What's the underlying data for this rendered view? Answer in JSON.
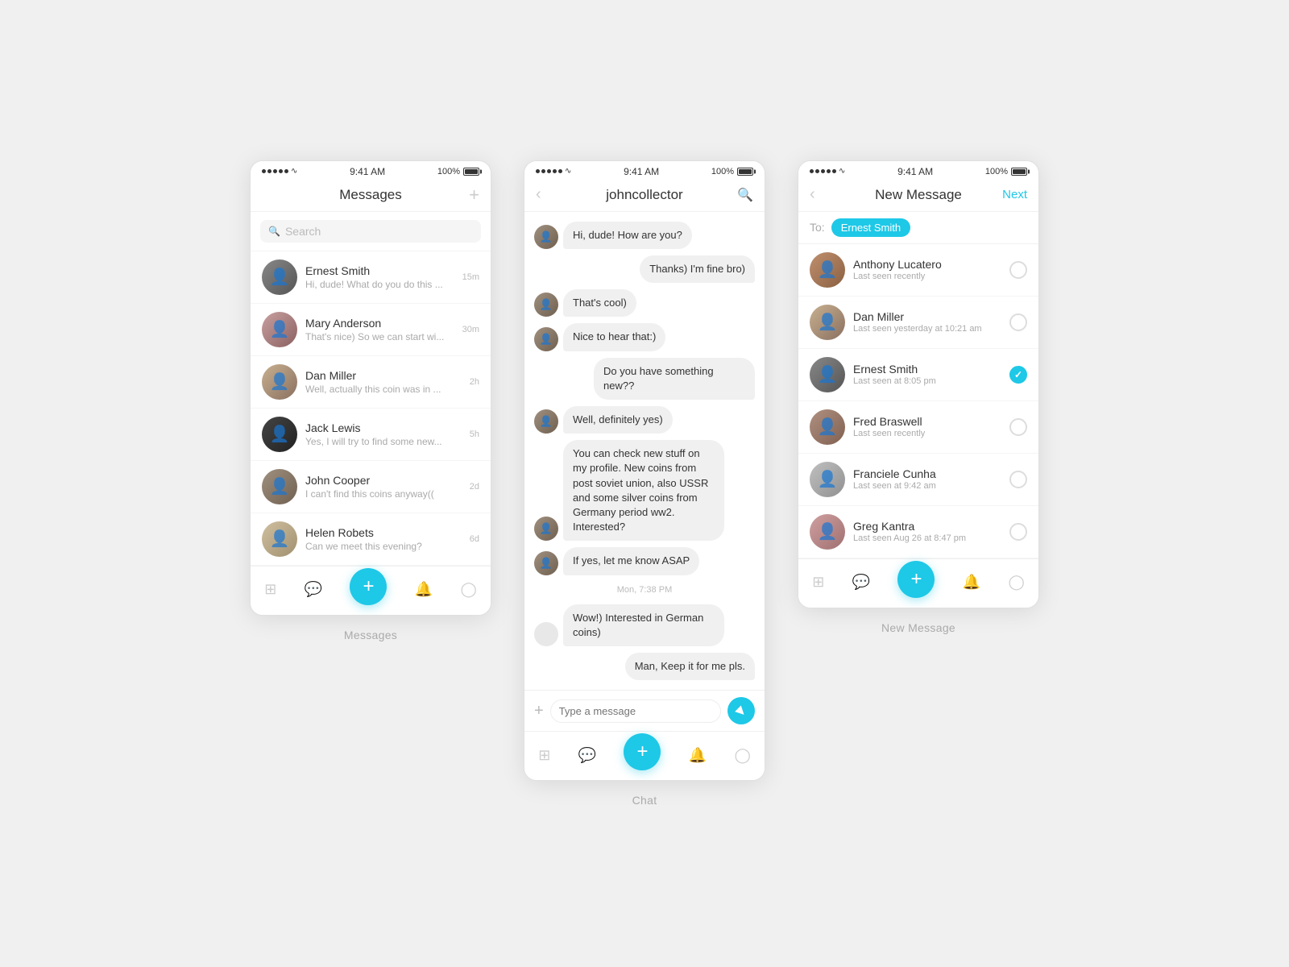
{
  "screens": [
    {
      "id": "messages",
      "label": "Messages",
      "statusBar": {
        "time": "9:41 AM",
        "battery": "100%"
      },
      "header": {
        "title": "Messages",
        "rightIcon": "plus"
      },
      "search": {
        "placeholder": "Search"
      },
      "messages": [
        {
          "id": 1,
          "name": "Ernest Smith",
          "preview": "Hi, dude! What do you do this ...",
          "time": "15m",
          "avatar": "ernest"
        },
        {
          "id": 2,
          "name": "Mary Anderson",
          "preview": "That's nice) So we can start wi...",
          "time": "30m",
          "avatar": "mary"
        },
        {
          "id": 3,
          "name": "Dan Miller",
          "preview": "Well, actually this coin was in ...",
          "time": "2h",
          "avatar": "dan"
        },
        {
          "id": 4,
          "name": "Jack Lewis",
          "preview": "Yes, I will try to find some new...",
          "time": "5h",
          "avatar": "jack"
        },
        {
          "id": 5,
          "name": "John Cooper",
          "preview": "I can't find this coins anyway((",
          "time": "2d",
          "avatar": "john"
        },
        {
          "id": 6,
          "name": "Helen Robets",
          "preview": "Can we meet this evening?",
          "time": "6d",
          "avatar": "helen"
        }
      ],
      "nav": [
        "grid",
        "chat",
        "plus",
        "bell",
        "person"
      ]
    },
    {
      "id": "chat",
      "label": "Chat",
      "statusBar": {
        "time": "9:41 AM",
        "battery": "100%"
      },
      "header": {
        "title": "johncollector",
        "leftIcon": "back",
        "rightIcon": "search"
      },
      "messages": [
        {
          "side": "left",
          "text": "Hi, dude! How are you?",
          "avatar": "john"
        },
        {
          "side": "right",
          "text": "Thanks) I'm fine bro)"
        },
        {
          "side": "left",
          "text": "That's cool)",
          "avatar": "john"
        },
        {
          "side": "left",
          "text": "Nice to hear that:)",
          "avatar": "john"
        },
        {
          "side": "right",
          "text": "Do you have something new??"
        },
        {
          "side": "left",
          "text": "Well, definitely yes)",
          "avatar": "john"
        },
        {
          "side": "left",
          "text": "You can check new stuff on my profile. New coins from post soviet union, also USSR and some silver coins from Germany period ww2. Interested?",
          "avatar": "john"
        },
        {
          "side": "left",
          "text": "If yes, let me know ASAP",
          "avatar": "john"
        },
        {
          "side": "timestamp",
          "text": "Mon, 7:38 PM"
        },
        {
          "side": "left",
          "text": "Wow!) Interested in German coins)",
          "avatar": "empty"
        },
        {
          "side": "right",
          "text": "Man, Keep it for me pls."
        }
      ],
      "inputPlaceholder": "Type a message",
      "nav": [
        "grid",
        "chat",
        "plus",
        "bell",
        "person"
      ]
    },
    {
      "id": "new-message",
      "label": "New Message",
      "statusBar": {
        "time": "9:41 AM",
        "battery": "100%"
      },
      "header": {
        "title": "New Message",
        "leftIcon": "back",
        "rightLabel": "Next"
      },
      "toChip": "Ernest Smith",
      "contacts": [
        {
          "id": 1,
          "name": "Anthony Lucatero",
          "status": "Last seen recently",
          "avatar": "anthony",
          "checked": false
        },
        {
          "id": 2,
          "name": "Dan Miller",
          "status": "Last seen yesterday at 10:21 am",
          "avatar": "dan",
          "checked": false
        },
        {
          "id": 3,
          "name": "Ernest Smith",
          "status": "Last seen at 8:05 pm",
          "avatar": "ernest",
          "checked": true
        },
        {
          "id": 4,
          "name": "Fred Braswell",
          "status": "Last seen recently",
          "avatar": "fred",
          "checked": false
        },
        {
          "id": 5,
          "name": "Franciele Cunha",
          "status": "Last seen at 9:42 am",
          "avatar": "franciele",
          "checked": false
        },
        {
          "id": 6,
          "name": "Greg Kantra",
          "status": "Last seen Aug 26 at 8:47 pm",
          "avatar": "greg",
          "checked": false
        }
      ],
      "nav": [
        "grid",
        "chat",
        "plus",
        "bell",
        "person"
      ]
    }
  ]
}
